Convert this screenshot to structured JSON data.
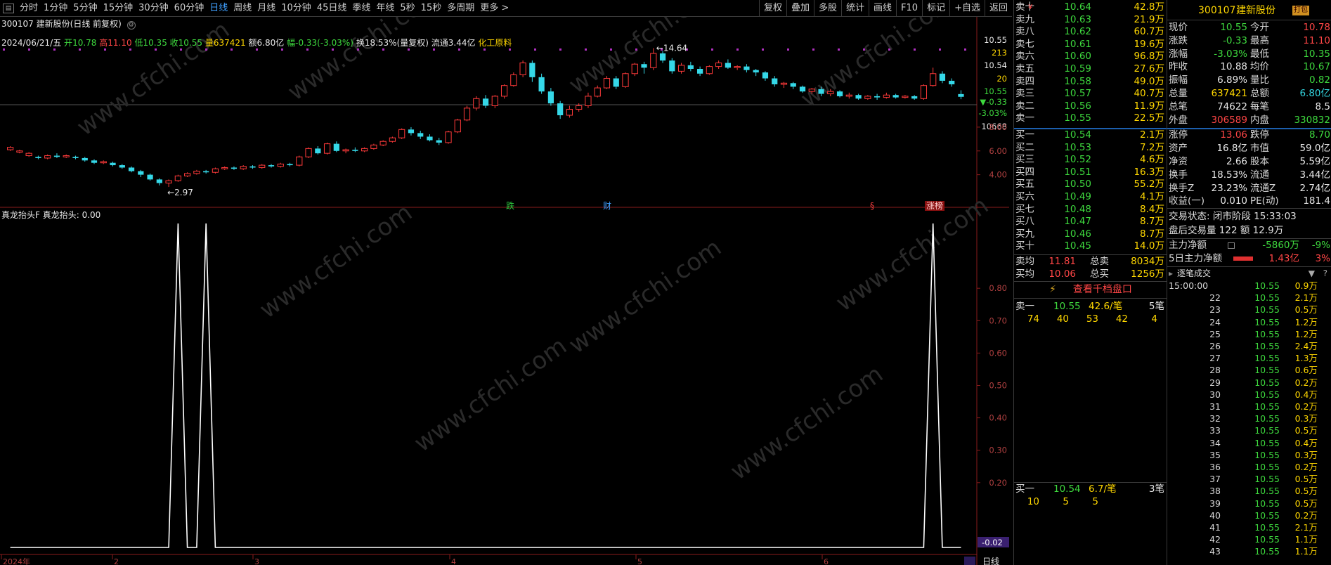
{
  "toolbar": {
    "periods": [
      "分时",
      "1分钟",
      "5分钟",
      "15分钟",
      "30分钟",
      "60分钟",
      "日线",
      "周线",
      "月线",
      "10分钟",
      "45日线",
      "季线",
      "年线",
      "5秒",
      "15秒",
      "多周期",
      "更多 >"
    ],
    "active_period": "日线",
    "right_buttons": [
      "复权",
      "叠加",
      "多股",
      "统计",
      "画线",
      "F10",
      "标记",
      "+自选",
      "返回"
    ]
  },
  "stock": {
    "code": "300107",
    "name": "建新股份",
    "mode": "(日线 前复权)"
  },
  "info_line": {
    "date": "2024/06/21/五",
    "open_label": "开",
    "open": "10.78",
    "high_label": "高",
    "high": "11.10",
    "low_label": "低",
    "low": "10.35",
    "close_label": "收",
    "close": "10.55",
    "vol_label": "量",
    "vol": "637421",
    "amt_label": "额",
    "amt": "6.80亿",
    "chg_label": "幅",
    "chg": "-0.33(-3.03%)",
    "turnover": "换18.53%(量复权)",
    "float": "流通3.44亿",
    "sector": "化工原料"
  },
  "price_axis": {
    "top_values": [
      "10.55",
      "213",
      "10.54",
      "20",
      "10.55",
      "▼-0.33",
      "-3.03%",
      "10668"
    ],
    "ticks": [
      "8.00",
      "6.00",
      "4.00"
    ]
  },
  "annotations": {
    "high": "14.64",
    "low": "2.97",
    "markers": [
      "跌",
      "财",
      "§",
      "涨榜"
    ]
  },
  "indicator": {
    "title": "真龙抬头F 真龙抬头: 0.00",
    "ticks": [
      "0.80",
      "0.70",
      "0.60",
      "0.50",
      "0.40",
      "0.30",
      "0.20"
    ],
    "current": "-0.02"
  },
  "x_axis": {
    "labels": [
      "2024年",
      "2",
      "3",
      "4",
      "5",
      "6"
    ],
    "period_tab": "日线"
  },
  "watermark": "www.cfchi.com",
  "order_book": {
    "asks": [
      {
        "label": "卖十",
        "price": "10.64",
        "vol": "42.8万",
        "mark": "¥"
      },
      {
        "label": "卖九",
        "price": "10.63",
        "vol": "21.9万",
        "mark": ""
      },
      {
        "label": "卖八",
        "price": "10.62",
        "vol": "60.7万",
        "mark": ""
      },
      {
        "label": "卖七",
        "price": "10.61",
        "vol": "19.6万",
        "mark": ""
      },
      {
        "label": "卖六",
        "price": "10.60",
        "vol": "96.8万",
        "mark": ""
      },
      {
        "label": "卖五",
        "price": "10.59",
        "vol": "27.6万",
        "mark": ""
      },
      {
        "label": "卖四",
        "price": "10.58",
        "vol": "49.0万",
        "mark": ""
      },
      {
        "label": "卖三",
        "price": "10.57",
        "vol": "40.7万",
        "mark": ""
      },
      {
        "label": "卖二",
        "price": "10.56",
        "vol": "11.9万",
        "mark": ""
      },
      {
        "label": "卖一",
        "price": "10.55",
        "vol": "22.5万",
        "mark": ""
      }
    ],
    "bids": [
      {
        "label": "买一",
        "price": "10.54",
        "vol": "2.1万"
      },
      {
        "label": "买二",
        "price": "10.53",
        "vol": "7.2万"
      },
      {
        "label": "买三",
        "price": "10.52",
        "vol": "4.6万"
      },
      {
        "label": "买四",
        "price": "10.51",
        "vol": "16.3万"
      },
      {
        "label": "买五",
        "price": "10.50",
        "vol": "55.2万"
      },
      {
        "label": "买六",
        "price": "10.49",
        "vol": "4.1万"
      },
      {
        "label": "买七",
        "price": "10.48",
        "vol": "8.4万"
      },
      {
        "label": "买八",
        "price": "10.47",
        "vol": "8.7万"
      },
      {
        "label": "买九",
        "price": "10.46",
        "vol": "8.7万"
      },
      {
        "label": "买十",
        "price": "10.45",
        "vol": "14.0万"
      }
    ],
    "avg_sell_label": "卖均",
    "avg_sell": "11.81",
    "total_sell_label": "总卖",
    "total_sell": "8034万",
    "avg_buy_label": "买均",
    "avg_buy": "10.06",
    "total_buy_label": "总买",
    "total_buy": "1256万",
    "thousand_link": "查看千档盘口",
    "sell1_queue": {
      "label": "卖一",
      "price": "10.55",
      "avg": "42.6/笔",
      "count": "5笔",
      "orders": [
        "74",
        "40",
        "53",
        "42",
        "4"
      ]
    },
    "buy1_queue": {
      "label": "买一",
      "price": "10.54",
      "avg": "6.7/笔",
      "count": "3笔",
      "orders": [
        "10",
        "5",
        "5"
      ]
    }
  },
  "quote": {
    "header_code": "300107",
    "header_name": "建新股份",
    "badge": "打包",
    "rows": [
      {
        "l1": "现价",
        "v1": "10.55",
        "c1": "green",
        "l2": "今开",
        "v2": "10.78",
        "c2": "red"
      },
      {
        "l1": "涨跌",
        "v1": "-0.33",
        "c1": "green",
        "l2": "最高",
        "v2": "11.10",
        "c2": "red"
      },
      {
        "l1": "涨幅",
        "v1": "-3.03%",
        "c1": "green",
        "l2": "最低",
        "v2": "10.35",
        "c2": "green"
      },
      {
        "l1": "昨收",
        "v1": "10.88",
        "c1": "white",
        "l2": "均价",
        "v2": "10.67",
        "c2": "green"
      },
      {
        "l1": "振幅",
        "v1": "6.89%",
        "c1": "white",
        "l2": "量比",
        "v2": "0.82",
        "c2": "green"
      },
      {
        "l1": "总量",
        "v1": "637421",
        "c1": "yellow",
        "l2": "总额",
        "v2": "6.80亿",
        "c2": "cyan"
      },
      {
        "l1": "总笔",
        "v1": "74622",
        "c1": "white",
        "l2": "每笔",
        "v2": "8.5",
        "c2": "white"
      },
      {
        "l1": "外盘",
        "v1": "306589",
        "c1": "red",
        "l2": "内盘",
        "v2": "330832",
        "c2": "green"
      },
      {
        "l1": "涨停",
        "v1": "13.06",
        "c1": "red",
        "l2": "跌停",
        "v2": "8.70",
        "c2": "green"
      },
      {
        "l1": "资产",
        "v1": "16.8亿",
        "c1": "white",
        "l2": "市值",
        "v2": "59.0亿",
        "c2": "white"
      },
      {
        "l1": "净资",
        "v1": "2.66",
        "c1": "white",
        "l2": "股本",
        "v2": "5.59亿",
        "c2": "white"
      },
      {
        "l1": "换手",
        "v1": "18.53%",
        "c1": "white",
        "l2": "流通",
        "v2": "3.44亿",
        "c2": "white"
      },
      {
        "l1": "换手Z",
        "v1": "23.23%",
        "c1": "white",
        "l2": "流通Z",
        "v2": "2.74亿",
        "c2": "white"
      },
      {
        "l1": "收益(一)",
        "v1": "0.010",
        "c1": "white",
        "l2": "PE(动)",
        "v2": "181.4",
        "c2": "white"
      }
    ],
    "status": "交易状态: 闭市阶段 15:33:03",
    "after_hours": "盘后交易量 122 额 12.9万",
    "main_net_label": "主力净额",
    "main_net": "-5860万",
    "main_net_pct": "-9%",
    "main5_label": "5日主力净额",
    "main5": "1.43亿",
    "main5_pct": "3%",
    "ticks_title": "逐笔成交"
  },
  "ticks": [
    {
      "t": "15:00:00",
      "p": "10.55",
      "v": "0.9万"
    },
    {
      "t": "22",
      "p": "10.55",
      "v": "2.1万"
    },
    {
      "t": "23",
      "p": "10.55",
      "v": "0.5万"
    },
    {
      "t": "24",
      "p": "10.55",
      "v": "1.2万"
    },
    {
      "t": "25",
      "p": "10.55",
      "v": "1.2万"
    },
    {
      "t": "26",
      "p": "10.55",
      "v": "2.4万"
    },
    {
      "t": "27",
      "p": "10.55",
      "v": "1.3万"
    },
    {
      "t": "28",
      "p": "10.55",
      "v": "0.6万"
    },
    {
      "t": "29",
      "p": "10.55",
      "v": "0.2万"
    },
    {
      "t": "30",
      "p": "10.55",
      "v": "0.4万"
    },
    {
      "t": "31",
      "p": "10.55",
      "v": "0.2万"
    },
    {
      "t": "32",
      "p": "10.55",
      "v": "0.3万"
    },
    {
      "t": "33",
      "p": "10.55",
      "v": "0.5万"
    },
    {
      "t": "34",
      "p": "10.55",
      "v": "0.4万"
    },
    {
      "t": "35",
      "p": "10.55",
      "v": "0.3万"
    },
    {
      "t": "36",
      "p": "10.55",
      "v": "0.2万"
    },
    {
      "t": "37",
      "p": "10.55",
      "v": "0.5万"
    },
    {
      "t": "38",
      "p": "10.55",
      "v": "0.5万"
    },
    {
      "t": "39",
      "p": "10.55",
      "v": "0.5万"
    },
    {
      "t": "40",
      "p": "10.55",
      "v": "0.2万"
    },
    {
      "t": "41",
      "p": "10.55",
      "v": "2.1万"
    },
    {
      "t": "42",
      "p": "10.55",
      "v": "1.1万"
    },
    {
      "t": "43",
      "p": "10.55",
      "v": "1.1万"
    }
  ],
  "kline": [
    [
      6.1,
      6.3,
      6.4,
      6.0
    ],
    [
      5.9,
      6.0,
      6.1,
      5.8
    ],
    [
      5.6,
      5.8,
      5.9,
      5.5
    ],
    [
      5.5,
      5.4,
      5.6,
      5.3
    ],
    [
      5.4,
      5.6,
      5.7,
      5.3
    ],
    [
      5.6,
      5.5,
      5.8,
      5.4
    ],
    [
      5.5,
      5.6,
      5.7,
      5.4
    ],
    [
      5.5,
      5.4,
      5.6,
      5.3
    ],
    [
      5.4,
      5.2,
      5.5,
      5.1
    ],
    [
      5.2,
      5.0,
      5.3,
      4.9
    ],
    [
      5.0,
      5.1,
      5.2,
      4.9
    ],
    [
      5.0,
      4.8,
      5.1,
      4.7
    ],
    [
      4.8,
      4.6,
      4.9,
      4.5
    ],
    [
      4.6,
      4.3,
      4.7,
      4.2
    ],
    [
      4.3,
      4.0,
      4.4,
      3.8
    ],
    [
      4.0,
      3.6,
      4.1,
      3.5
    ],
    [
      3.6,
      3.3,
      3.7,
      3.1
    ],
    [
      3.3,
      3.5,
      3.6,
      2.97
    ],
    [
      3.5,
      3.9,
      4.0,
      3.4
    ],
    [
      3.9,
      4.1,
      4.2,
      3.8
    ],
    [
      4.1,
      4.3,
      4.4,
      4.0
    ],
    [
      4.3,
      4.2,
      4.4,
      4.1
    ],
    [
      4.2,
      4.5,
      4.6,
      4.1
    ],
    [
      4.5,
      4.6,
      4.7,
      4.4
    ],
    [
      4.6,
      4.5,
      4.7,
      4.4
    ],
    [
      4.5,
      4.7,
      4.8,
      4.4
    ],
    [
      4.7,
      4.6,
      4.8,
      4.5
    ],
    [
      4.6,
      4.8,
      4.9,
      4.5
    ],
    [
      4.8,
      4.7,
      4.9,
      4.6
    ],
    [
      4.7,
      4.9,
      5.0,
      4.6
    ],
    [
      4.9,
      4.8,
      5.0,
      4.7
    ],
    [
      4.8,
      5.5,
      5.6,
      4.7
    ],
    [
      5.5,
      6.2,
      6.3,
      5.4
    ],
    [
      6.2,
      5.8,
      6.4,
      5.7
    ],
    [
      5.8,
      6.6,
      6.7,
      5.7
    ],
    [
      6.6,
      6.0,
      6.8,
      5.9
    ],
    [
      6.0,
      6.1,
      6.2,
      5.8
    ],
    [
      6.1,
      6.0,
      6.3,
      5.9
    ],
    [
      6.0,
      6.2,
      6.3,
      5.9
    ],
    [
      6.2,
      6.5,
      6.6,
      6.1
    ],
    [
      6.5,
      6.8,
      6.9,
      6.4
    ],
    [
      6.8,
      7.1,
      7.2,
      6.7
    ],
    [
      7.1,
      7.8,
      7.9,
      7.0
    ],
    [
      7.8,
      7.5,
      8.0,
      7.3
    ],
    [
      7.5,
      7.2,
      7.7,
      7.0
    ],
    [
      7.2,
      6.9,
      7.4,
      6.8
    ],
    [
      6.9,
      6.7,
      7.1,
      6.5
    ],
    [
      6.7,
      7.6,
      7.7,
      6.6
    ],
    [
      7.6,
      8.6,
      8.7,
      7.5
    ],
    [
      8.6,
      9.6,
      9.8,
      8.5
    ],
    [
      9.6,
      10.4,
      10.6,
      9.4
    ],
    [
      10.4,
      9.8,
      10.7,
      9.6
    ],
    [
      9.8,
      10.6,
      10.7,
      9.6
    ],
    [
      10.6,
      11.5,
      11.6,
      10.4
    ],
    [
      11.5,
      12.4,
      12.6,
      11.4
    ],
    [
      12.4,
      13.4,
      13.6,
      12.2
    ],
    [
      13.4,
      12.2,
      13.6,
      11.8
    ],
    [
      12.2,
      11.0,
      12.5,
      10.8
    ],
    [
      11.0,
      10.0,
      11.3,
      9.8
    ],
    [
      10.0,
      9.0,
      10.2,
      8.7
    ],
    [
      9.0,
      9.5,
      9.8,
      8.8
    ],
    [
      9.5,
      9.8,
      10.0,
      9.3
    ],
    [
      9.8,
      10.6,
      10.9,
      9.6
    ],
    [
      10.6,
      11.3,
      11.5,
      10.5
    ],
    [
      11.3,
      12.1,
      12.3,
      11.2
    ],
    [
      12.1,
      11.4,
      12.3,
      11.2
    ],
    [
      11.4,
      12.5,
      12.6,
      11.3
    ],
    [
      12.5,
      13.3,
      13.4,
      12.3
    ],
    [
      13.3,
      13.0,
      13.5,
      12.5
    ],
    [
      13.0,
      14.2,
      14.64,
      12.8
    ],
    [
      14.2,
      13.6,
      14.4,
      13.4
    ],
    [
      13.6,
      12.7,
      13.8,
      12.5
    ],
    [
      12.7,
      13.2,
      13.4,
      12.5
    ],
    [
      13.2,
      12.9,
      13.5,
      12.7
    ],
    [
      12.9,
      12.5,
      13.1,
      12.3
    ],
    [
      12.5,
      13.1,
      13.2,
      12.4
    ],
    [
      13.1,
      13.4,
      13.6,
      12.9
    ],
    [
      13.4,
      13.0,
      13.7,
      12.9
    ],
    [
      13.0,
      13.1,
      13.2,
      12.8
    ],
    [
      13.1,
      12.8,
      13.3,
      12.6
    ],
    [
      12.8,
      12.6,
      12.9,
      12.3
    ],
    [
      12.6,
      12.1,
      12.7,
      11.9
    ],
    [
      12.1,
      11.6,
      12.3,
      11.4
    ],
    [
      11.6,
      11.7,
      11.8,
      11.3
    ],
    [
      11.7,
      11.4,
      11.8,
      11.2
    ],
    [
      11.4,
      11.0,
      11.5,
      10.9
    ],
    [
      11.0,
      11.2,
      11.3,
      10.8
    ],
    [
      11.2,
      10.8,
      11.4,
      10.6
    ],
    [
      10.8,
      11.0,
      11.2,
      10.6
    ],
    [
      11.0,
      10.6,
      11.1,
      10.5
    ],
    [
      10.6,
      10.7,
      10.9,
      10.4
    ],
    [
      10.7,
      10.4,
      10.8,
      10.3
    ],
    [
      10.4,
      10.6,
      10.7,
      10.3
    ],
    [
      10.6,
      10.5,
      10.8,
      10.3
    ],
    [
      10.5,
      10.7,
      10.9,
      10.4
    ],
    [
      10.7,
      10.5,
      10.8,
      10.4
    ],
    [
      10.5,
      10.6,
      10.7,
      10.4
    ],
    [
      10.6,
      10.4,
      10.7,
      10.3
    ],
    [
      10.4,
      11.5,
      11.6,
      10.3
    ],
    [
      11.5,
      12.5,
      13.0,
      11.4
    ],
    [
      12.5,
      11.9,
      12.7,
      11.7
    ],
    [
      11.9,
      11.6,
      12.1,
      11.4
    ],
    [
      10.78,
      10.55,
      11.1,
      10.35
    ]
  ],
  "signals": [
    {
      "bar": 18,
      "v": 1.0
    },
    {
      "bar": 21,
      "v": 1.0
    },
    {
      "bar": 99,
      "v": 1.0
    }
  ]
}
